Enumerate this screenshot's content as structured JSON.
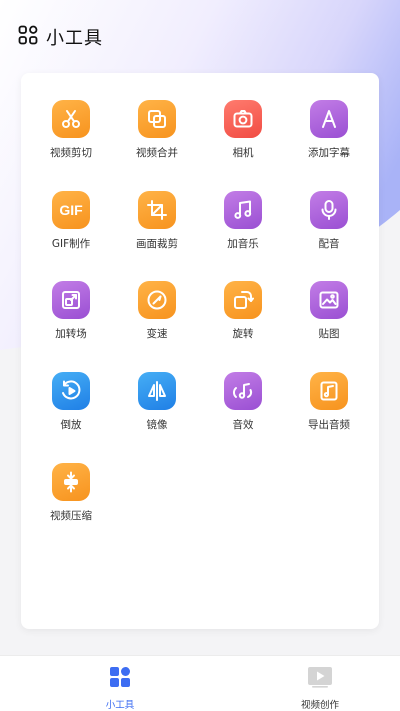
{
  "header": {
    "title": "小工具",
    "icon": "apps-grid-icon"
  },
  "tools": [
    {
      "label": "视频剪切",
      "icon": "scissors-icon",
      "color": "#f7931e"
    },
    {
      "label": "视频合并",
      "icon": "merge-squares-icon",
      "color": "#f7931e"
    },
    {
      "label": "相机",
      "icon": "camera-icon",
      "color": "#f14c43"
    },
    {
      "label": "添加字幕",
      "icon": "letter-a-icon",
      "color": "#9a4fd3"
    },
    {
      "label": "GIF制作",
      "icon": "gif-icon",
      "color": "#f7931e",
      "icon_text": "GIF"
    },
    {
      "label": "画面裁剪",
      "icon": "crop-icon",
      "color": "#f7931e"
    },
    {
      "label": "加音乐",
      "icon": "music-note-icon",
      "color": "#9a4fd3"
    },
    {
      "label": "配音",
      "icon": "microphone-icon",
      "color": "#9a4fd3"
    },
    {
      "label": "加转场",
      "icon": "transition-icon",
      "color": "#9a4fd3"
    },
    {
      "label": "变速",
      "icon": "speedometer-icon",
      "color": "#f7931e"
    },
    {
      "label": "旋转",
      "icon": "rotate-icon",
      "color": "#f7931e"
    },
    {
      "label": "贴图",
      "icon": "image-icon",
      "color": "#9a4fd3"
    },
    {
      "label": "倒放",
      "icon": "rewind-icon",
      "color": "#1f7fe6"
    },
    {
      "label": "镜像",
      "icon": "mirror-icon",
      "color": "#1f7fe6"
    },
    {
      "label": "音效",
      "icon": "sound-effect-icon",
      "color": "#9a4fd3"
    },
    {
      "label": "导出音频",
      "icon": "export-audio-icon",
      "color": "#f7931e"
    },
    {
      "label": "视频压缩",
      "icon": "compress-icon",
      "color": "#f7931e"
    }
  ],
  "tabbar": {
    "tabs": [
      {
        "label": "小工具",
        "icon": "tools-grid-icon",
        "active": true,
        "color": "#3d6df2"
      },
      {
        "label": "视频创作",
        "icon": "video-play-icon",
        "active": false,
        "color": "#333333"
      }
    ]
  }
}
